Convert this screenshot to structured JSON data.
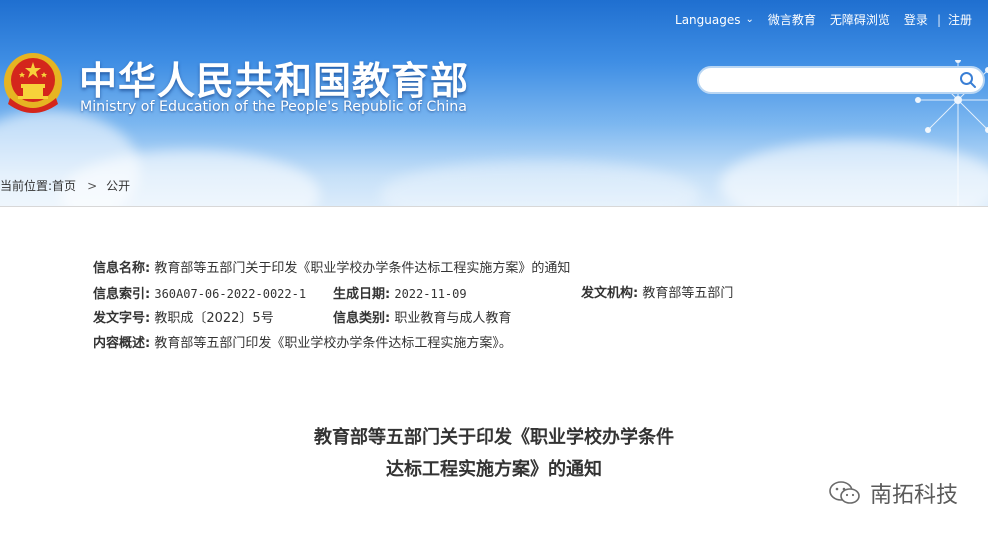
{
  "topnav": {
    "languages": "Languages",
    "wechat": "微言教育",
    "accessibility": "无障碍浏览",
    "login": "登录",
    "separator": "|",
    "register": "注册"
  },
  "site": {
    "title": "中华人民共和国教育部",
    "subtitle": "Ministry of Education of the People's Republic of China"
  },
  "search": {
    "placeholder": "",
    "value": ""
  },
  "breadcrumb": {
    "prefix": "当前位置:",
    "home": "首页",
    "current": "公开"
  },
  "meta": {
    "name_label": "信息名称:",
    "name_value": "教育部等五部门关于印发《职业学校办学条件达标工程实施方案》的通知",
    "index_label": "信息索引:",
    "index_value": "360A07-06-2022-0022-1",
    "date_label": "生成日期:",
    "date_value": "2022-11-09",
    "org_label": "发文机构:",
    "org_value": "教育部等五部门",
    "docno_label": "发文字号:",
    "docno_value": "教职成〔2022〕5号",
    "category_label": "信息类别:",
    "category_value": "职业教育与成人教育",
    "summary_label": "内容概述:",
    "summary_value": "教育部等五部门印发《职业学校办学条件达标工程实施方案》。"
  },
  "document": {
    "title_line1": "教育部等五部门关于印发《职业学校办学条件",
    "title_line2": "达标工程实施方案》的通知"
  },
  "watermark": {
    "text": "南拓科技"
  },
  "colors": {
    "header_blue": "#2f7fdc",
    "header_light": "#dcecfb",
    "text": "#333333"
  }
}
